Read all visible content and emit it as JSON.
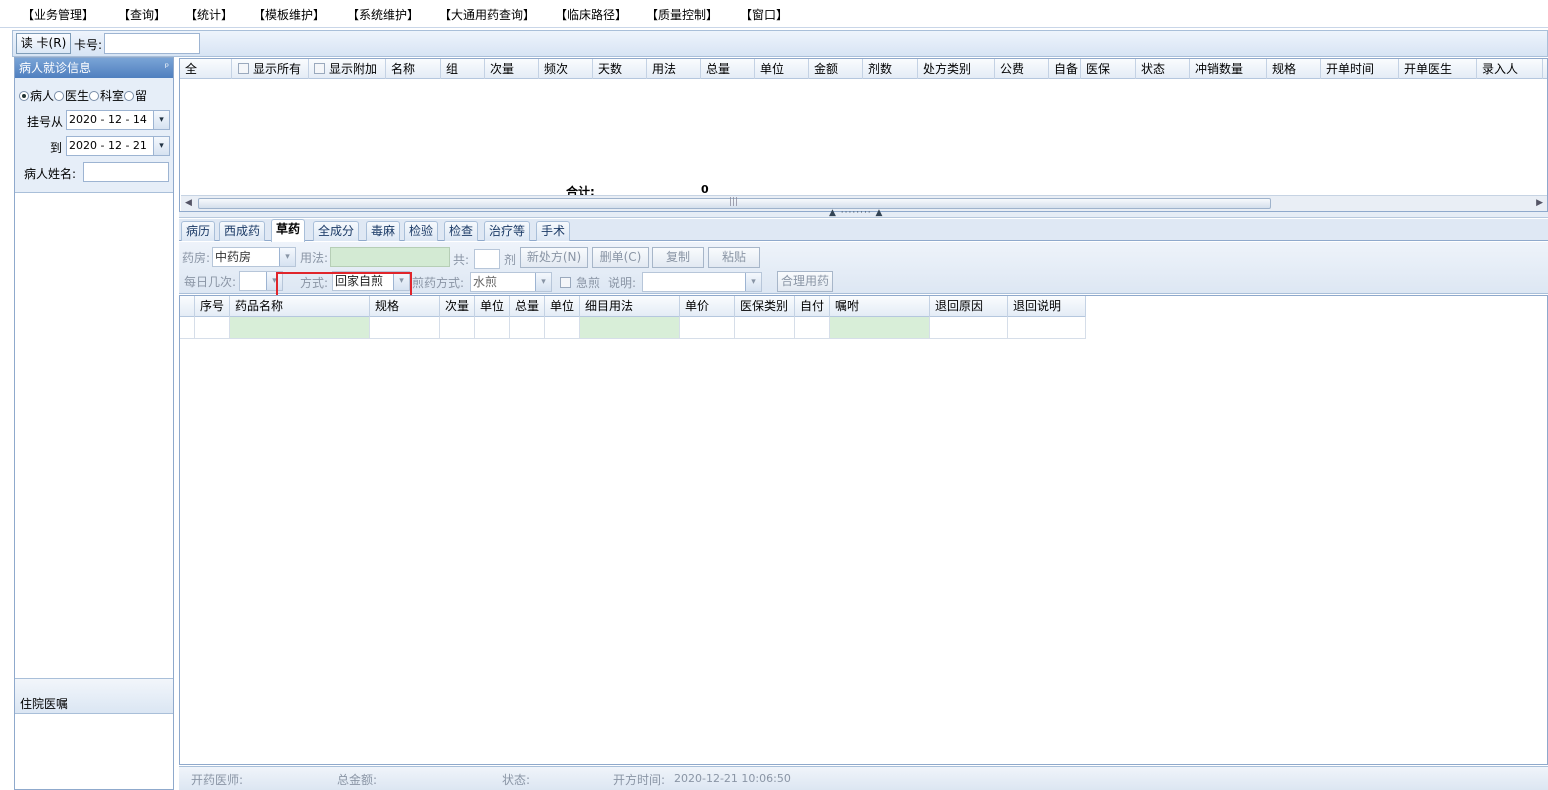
{
  "menubar": {
    "items": [
      "【业务管理】",
      "【查询】",
      "【统计】",
      "【模板维护】",
      "【系统维护】",
      "【大通用药查询】",
      "【临床路径】",
      "【质量控制】",
      "【窗口】"
    ]
  },
  "toolbar": {
    "read_card_label": "读 卡(R)",
    "card_no_label": "卡号:",
    "card_no_value": ""
  },
  "left_panel": {
    "title": "病人就诊信息",
    "pin_icon": "📌",
    "radios": [
      {
        "label": "病人",
        "selected": true
      },
      {
        "label": "医生",
        "selected": false
      },
      {
        "label": "科室",
        "selected": false
      },
      {
        "label": "留",
        "selected": false
      }
    ],
    "reg_from_label": "挂号从",
    "reg_from_value": "2020 - 12 - 14",
    "reg_to_label": "到",
    "reg_to_value": "2020 - 12 - 21",
    "patient_name_label": "病人姓名:",
    "patient_name_value": "",
    "inpatient_orders_label": "住院医嘱"
  },
  "top_grid": {
    "columns": [
      "全",
      "显示所有",
      "显示附加",
      "名称",
      "组",
      "次量",
      "频次",
      "天数",
      "用法",
      "总量",
      "单位",
      "金额",
      "剂数",
      "处方类别",
      "公费",
      "自备",
      "医保",
      "状态",
      "冲销数量",
      "规格",
      "开单时间",
      "开单医生",
      "录入人"
    ],
    "total_label": "合计:",
    "total_value": "0"
  },
  "tabs": {
    "items": [
      "病历",
      "西成药",
      "草药",
      "全成分",
      "毒麻",
      "检验",
      "检查",
      "治疗等",
      "手术"
    ],
    "active": "草药"
  },
  "form": {
    "pharmacy_label": "药房:",
    "pharmacy_value": "中药房",
    "usage_label": "用法:",
    "usage_value": "",
    "total_label": "共:",
    "total_value": "",
    "dose_unit": "剂",
    "new_rx_btn": "新处方(N)",
    "delete_rx_btn": "删单(C)",
    "copy_btn": "复制",
    "paste_btn": "粘贴",
    "daily_times_label": "每日几次:",
    "daily_times_value": "",
    "method_label": "方式:",
    "method_value": "回家自煎",
    "decoct_label": "煎药方式:",
    "decoct_value": "水煎",
    "urgent_label": "急煎",
    "note_label": "说明:",
    "note_value": "",
    "rational_btn": "合理用药"
  },
  "bottom_grid": {
    "columns": [
      "序号",
      "药品名称",
      "规格",
      "次量",
      "单位",
      "总量",
      "单位",
      "细目用法",
      "单价",
      "医保类别",
      "自付",
      "嘱咐",
      "退回原因",
      "退回说明"
    ]
  },
  "statusbar": {
    "doctor_label": "开药医师:",
    "doctor_value": "",
    "amount_label": "总金额:",
    "amount_value": "",
    "status_label": "状态:",
    "status_value": "",
    "time_label": "开方时间:",
    "time_value": "2020-12-21 10:06:50"
  },
  "colors": {
    "accent": "#4f7fbf",
    "highlight_box": "#e0252b",
    "editable_cell": "#d8eed8"
  }
}
